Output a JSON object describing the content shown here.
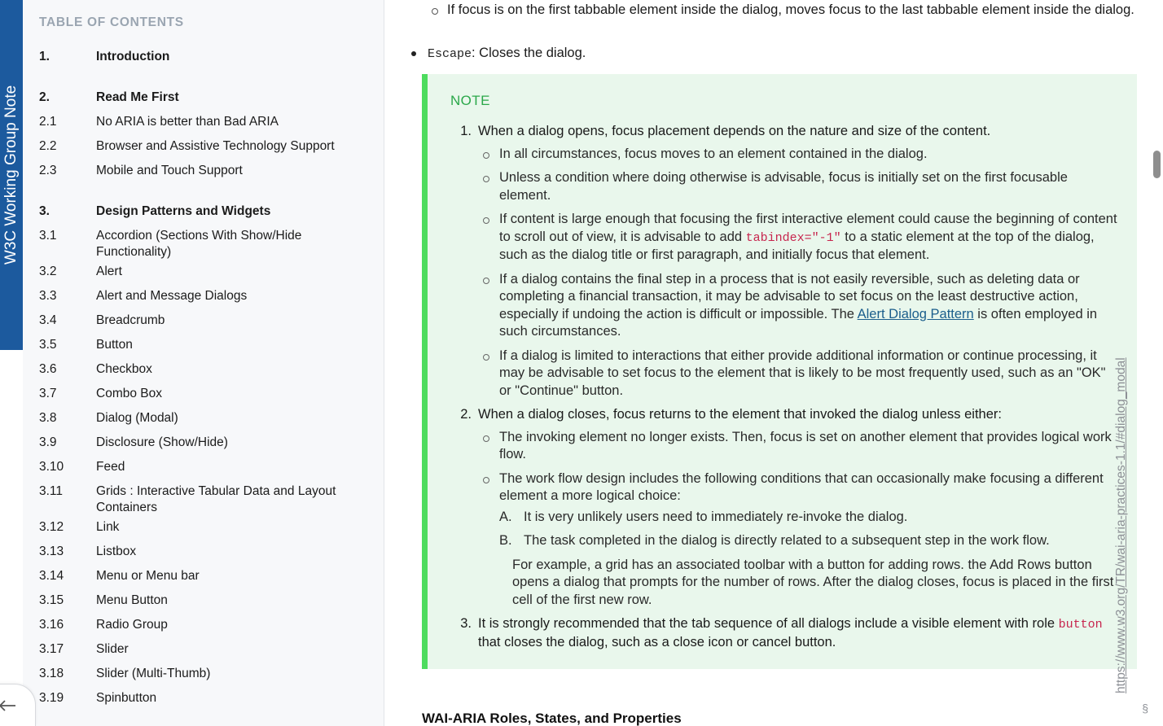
{
  "band": {
    "label": "W3C Working Group Note",
    "color": "#1c5a9e"
  },
  "sidebar": {
    "title": "TABLE OF CONTENTS",
    "back_icon": "back-arrow-icon",
    "items": [
      {
        "num": "1.",
        "label": "Introduction",
        "section": true,
        "gap": false
      },
      {
        "num": "2.",
        "label": "Read Me First",
        "section": true,
        "gap": true
      },
      {
        "num": "2.1",
        "label": "No ARIA is better than Bad ARIA",
        "section": false,
        "gap": false
      },
      {
        "num": "2.2",
        "label": "Browser and Assistive Technology Support",
        "section": false,
        "gap": false
      },
      {
        "num": "2.3",
        "label": "Mobile and Touch Support",
        "section": false,
        "gap": false
      },
      {
        "num": "3.",
        "label": "Design Patterns and Widgets",
        "section": true,
        "gap": true
      },
      {
        "num": "3.1",
        "label": "Accordion (Sections With Show/Hide Functionality)",
        "section": false,
        "gap": false
      },
      {
        "num": "3.2",
        "label": "Alert",
        "section": false,
        "gap": false
      },
      {
        "num": "3.3",
        "label": "Alert and Message Dialogs",
        "section": false,
        "gap": false
      },
      {
        "num": "3.4",
        "label": "Breadcrumb",
        "section": false,
        "gap": false
      },
      {
        "num": "3.5",
        "label": "Button",
        "section": false,
        "gap": false
      },
      {
        "num": "3.6",
        "label": "Checkbox",
        "section": false,
        "gap": false
      },
      {
        "num": "3.7",
        "label": "Combo Box",
        "section": false,
        "gap": false
      },
      {
        "num": "3.8",
        "label": "Dialog (Modal)",
        "section": false,
        "gap": false
      },
      {
        "num": "3.9",
        "label": "Disclosure (Show/Hide)",
        "section": false,
        "gap": false
      },
      {
        "num": "3.10",
        "label": "Feed",
        "section": false,
        "gap": false
      },
      {
        "num": "3.11",
        "label": "Grids : Interactive Tabular Data and Layout Containers",
        "section": false,
        "gap": false
      },
      {
        "num": "3.12",
        "label": "Link",
        "section": false,
        "gap": false
      },
      {
        "num": "3.13",
        "label": "Listbox",
        "section": false,
        "gap": false
      },
      {
        "num": "3.14",
        "label": "Menu or Menu bar",
        "section": false,
        "gap": false
      },
      {
        "num": "3.15",
        "label": "Menu Button",
        "section": false,
        "gap": false
      },
      {
        "num": "3.16",
        "label": "Radio Group",
        "section": false,
        "gap": false
      },
      {
        "num": "3.17",
        "label": "Slider",
        "section": false,
        "gap": false
      },
      {
        "num": "3.18",
        "label": "Slider (Multi-Thumb)",
        "section": false,
        "gap": false
      },
      {
        "num": "3.19",
        "label": "Spinbutton",
        "section": false,
        "gap": false
      }
    ]
  },
  "content": {
    "top_fragment": "If focus is on the first tabbable element inside the dialog, moves focus to the last tabbable element inside the dialog.",
    "escape_code": "Escape",
    "escape_text": ": Closes the dialog.",
    "note": {
      "label": "NOTE",
      "item1": {
        "num": "1.",
        "text": "When a dialog opens, focus placement depends on the nature and size of the content.",
        "subs": [
          "In all circumstances, focus moves to an element contained in the dialog.",
          "Unless a condition where doing otherwise is advisable, focus is initially set on the first focusable element."
        ],
        "sub3_before": "If content is large enough that focusing the first interactive element could cause the beginning of content to scroll out of view, it is advisable to add ",
        "sub3_code": "tabindex=\"-1\"",
        "sub3_after": " to a static element at the top of the dialog, such as the dialog title or first paragraph, and initially focus that element.",
        "sub4_before": "If a dialog contains the final step in a process that is not easily reversible, such as deleting data or completing a financial transaction, it may be advisable to set focus on the least destructive action, especially if undoing the action is difficult or impossible. The ",
        "sub4_link": "Alert Dialog Pattern",
        "sub4_after": " is often employed in such circumstances.",
        "sub5": "If a dialog is limited to interactions that either provide additional information or continue processing, it may be advisable to set focus to the element that is likely to be most frequently used, such as an \"OK\" or \"Continue\" button."
      },
      "item2": {
        "num": "2.",
        "text": "When a dialog closes, focus returns to the element that invoked the dialog unless either:",
        "sub1": "The invoking element no longer exists. Then, focus is set on another element that provides logical work flow.",
        "sub2": "The work flow design includes the following conditions that can occasionally make focusing a different element a more logical choice:",
        "alpha": [
          {
            "marker": "A.",
            "text": "It is very unlikely users need to immediately re-invoke the dialog."
          },
          {
            "marker": "B.",
            "text": "The task completed in the dialog is directly related to a subsequent step in the work flow."
          }
        ],
        "example": "For example, a grid has an associated toolbar with a button for adding rows. the Add Rows button opens a dialog that prompts for the number of rows. After the dialog closes, focus is placed in the first cell of the first new row."
      },
      "item3": {
        "num": "3.",
        "before": "It is strongly recommended that the tab sequence of all dialogs include a visible element with role ",
        "code": "button",
        "after": " that closes the dialog, such as a close icon or cancel button."
      }
    },
    "sub_heading": "WAI-ARIA Roles, States, and Properties"
  },
  "footer": {
    "url": "https://www.w3.org/TR/wai-aria-practices-1.1/#dialog_modal",
    "page_mark": "§"
  },
  "colors": {
    "band_blue": "#1c5a9e",
    "note_bg": "#e9f7ec",
    "note_border": "#4ddc5e",
    "note_label": "#2ba84a",
    "code_red": "#c7254e",
    "link_blue": "#1b5e8c"
  }
}
